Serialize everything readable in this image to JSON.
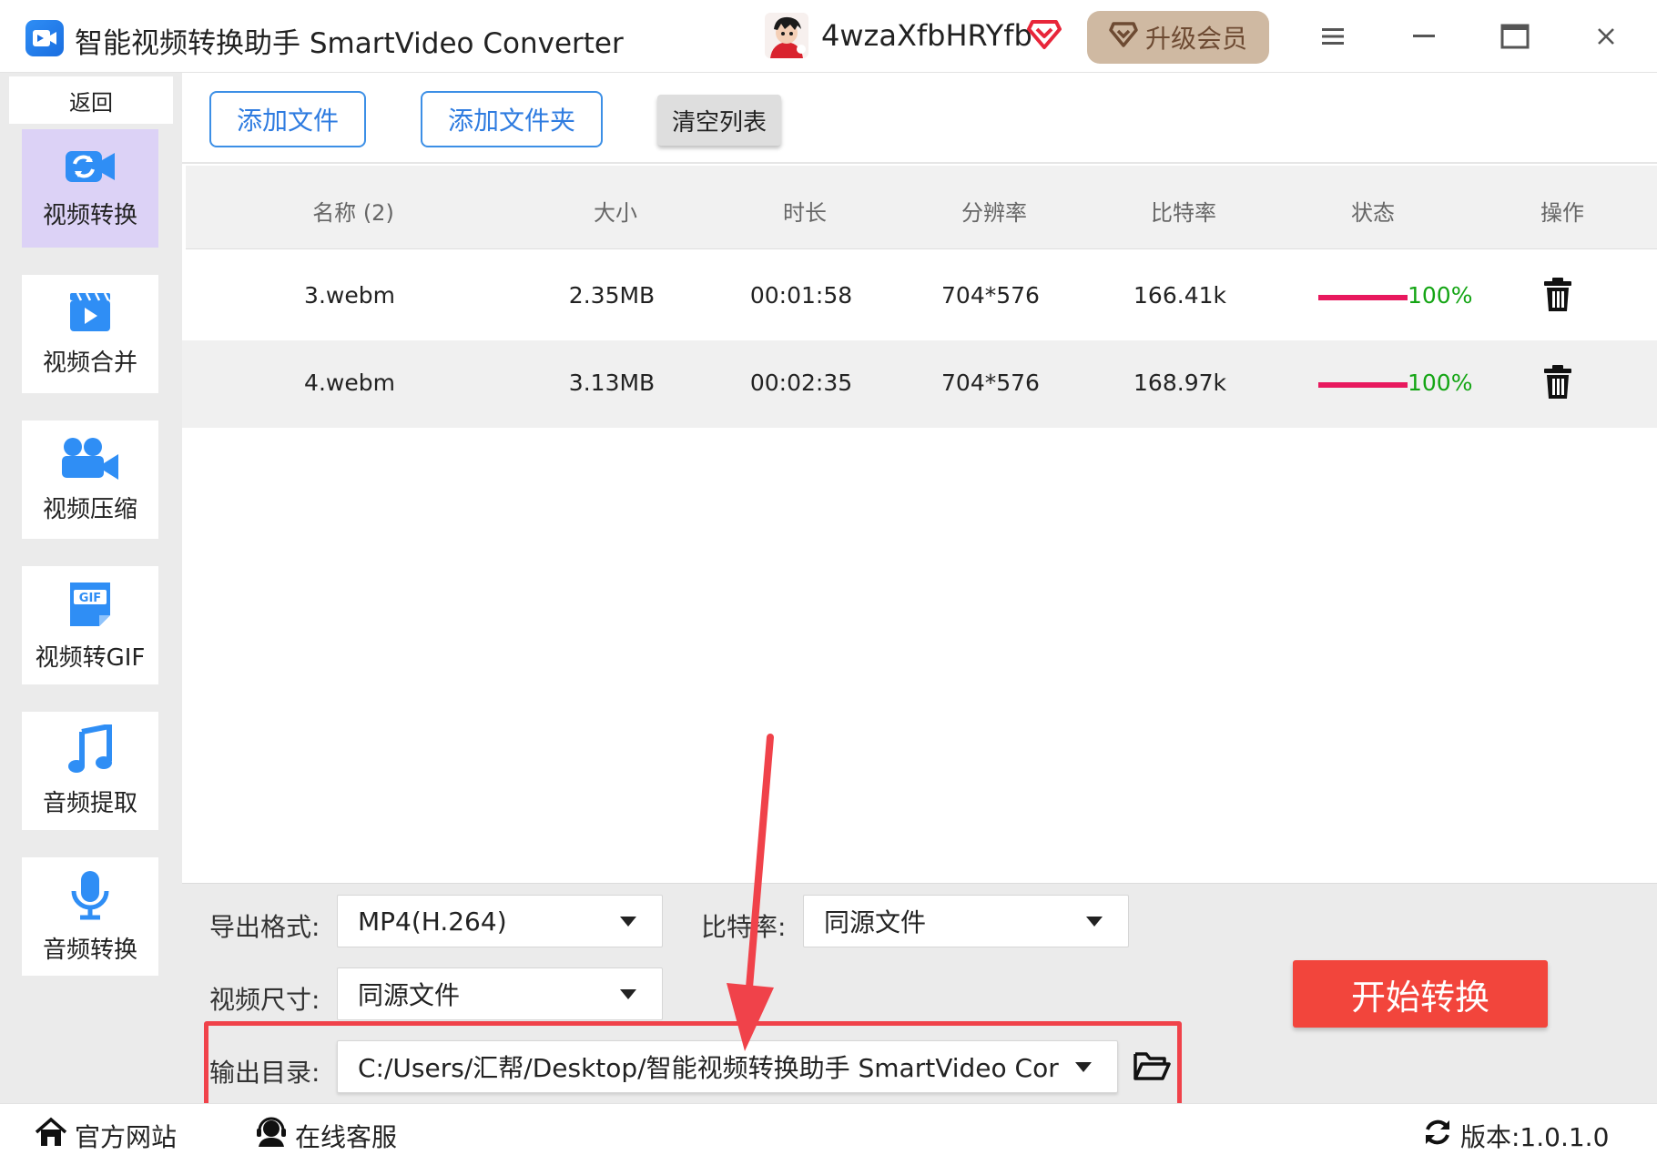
{
  "window": {
    "title": "智能视频转换助手 SmartVideo Converter",
    "username": "4wzaXfbHRYfb",
    "upgrade_label": "升级会员",
    "vip_icon": "diamond-icon",
    "accent": "#2f8ef5"
  },
  "sidebar": {
    "back_label": "返回",
    "items": [
      {
        "label": "视频转换",
        "icon": "video-convert-icon",
        "active": true
      },
      {
        "label": "视频合并",
        "icon": "video-merge-icon",
        "active": false
      },
      {
        "label": "视频压缩",
        "icon": "video-compress-icon",
        "active": false
      },
      {
        "label": "视频转GIF",
        "icon": "gif-icon",
        "active": false
      },
      {
        "label": "音频提取",
        "icon": "music-note-icon",
        "active": false
      },
      {
        "label": "音频转换",
        "icon": "microphone-icon",
        "active": false
      }
    ]
  },
  "toolbar": {
    "add_file": "添加文件",
    "add_folder": "添加文件夹",
    "clear_list": "清空列表"
  },
  "table": {
    "columns": [
      "名称 (2)",
      "大小",
      "时长",
      "分辨率",
      "比特率",
      "状态",
      "操作"
    ],
    "rows": [
      {
        "name": "3.webm",
        "size": "2.35MB",
        "duration": "00:01:58",
        "resolution": "704*576",
        "bitrate": "166.41k",
        "progress": 1.0,
        "progress_label": "100%"
      },
      {
        "name": "4.webm",
        "size": "3.13MB",
        "duration": "00:02:35",
        "resolution": "704*576",
        "bitrate": "168.97k",
        "progress": 1.0,
        "progress_label": "100%"
      }
    ],
    "progress_color": "#e8195e",
    "status_color": "#14a514"
  },
  "settings": {
    "format_label": "导出格式:",
    "format_value": "MP4(H.264)",
    "bitrate_label": "比特率:",
    "bitrate_value": "同源文件",
    "size_label": "视频尺寸:",
    "size_value": "同源文件",
    "output_label": "输出目录:",
    "output_value": "C:/Users/汇帮/Desktop/智能视频转换助手 SmartVideo Cor",
    "start_label": "开始转换",
    "start_color": "#f2453c"
  },
  "footer": {
    "website": "官方网站",
    "support": "在线客服",
    "version": "版本:1.0.1.0"
  }
}
